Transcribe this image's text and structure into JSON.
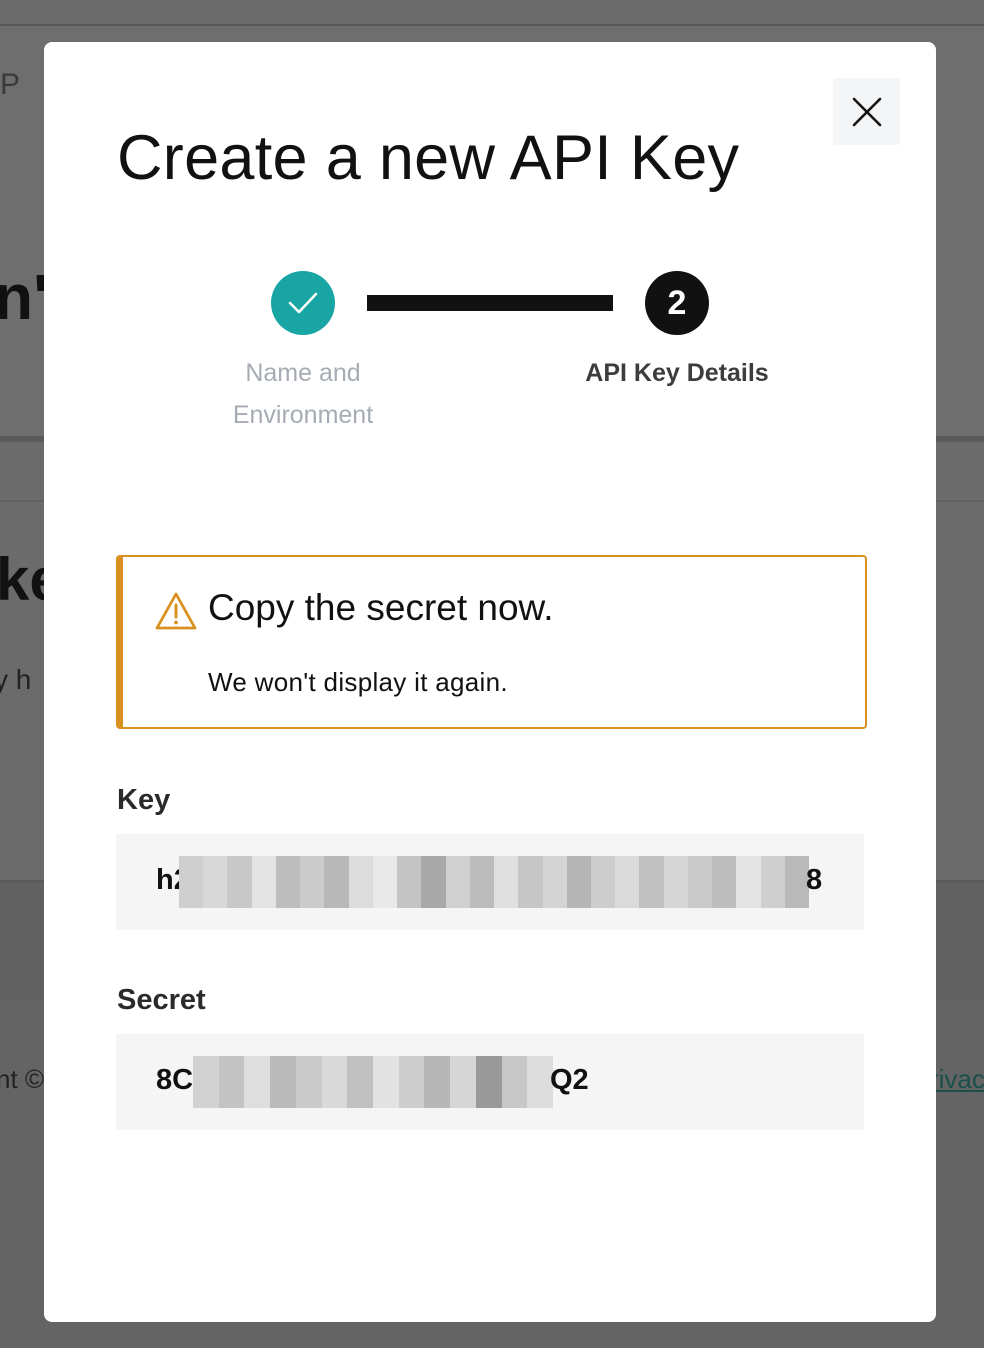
{
  "background_page": {
    "fragment_header": "P",
    "fragment_heading_1": "n'",
    "fragment_heading_2": "ke",
    "fragment_text": "y h",
    "fragment_copyright": "nt ©",
    "fragment_privacy_link": "rivac"
  },
  "modal": {
    "title": "Create a new API Key",
    "close_icon": "close-icon",
    "steps": [
      {
        "number": "1",
        "label": "Name and Environment",
        "status": "completed",
        "icon": "check-icon",
        "color": "#1aa5a5"
      },
      {
        "number": "2",
        "label": "API Key Details",
        "status": "active",
        "color": "#111111"
      }
    ],
    "warning": {
      "icon": "warning-triangle-icon",
      "accent_color": "#d9901e",
      "title": "Copy the secret now.",
      "message": "We won't display it again."
    },
    "key_field": {
      "label": "Key",
      "value_prefix": "h2",
      "value_suffix": "8",
      "redacted": true
    },
    "secret_field": {
      "label": "Secret",
      "value_prefix": "8C",
      "value_suffix": "Q2",
      "redacted": true
    }
  }
}
